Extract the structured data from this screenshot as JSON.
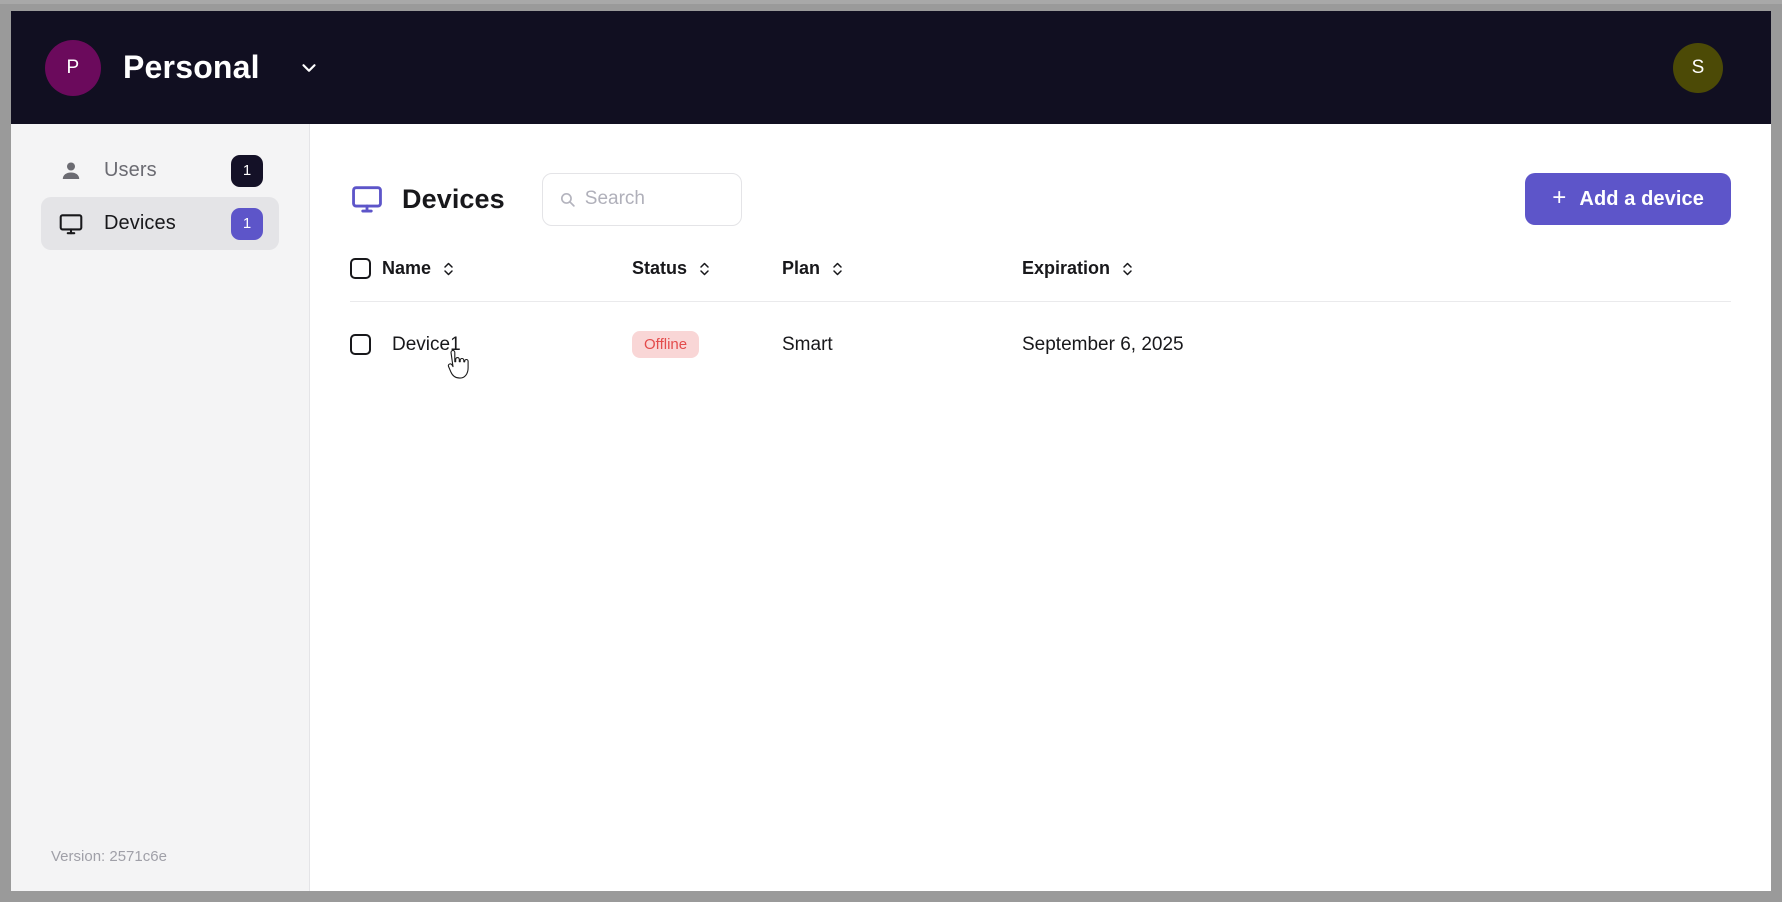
{
  "topbar": {
    "org_avatar_initial": "P",
    "org_avatar_color": "#6b0a5c",
    "org_name": "Personal",
    "org_chevron_icon": "chevron-down-icon",
    "user_avatar_initial": "S",
    "user_avatar_color": "#4c4a06",
    "background_color": "#110f21"
  },
  "sidebar": {
    "items": [
      {
        "icon": "user-icon",
        "label": "Users",
        "badge": "1",
        "badge_color": "#141127",
        "active": false
      },
      {
        "icon": "monitor-icon",
        "label": "Devices",
        "badge": "1",
        "badge_color": "#5d55c9",
        "active": true
      }
    ],
    "version": "Version: 2571c6e"
  },
  "main": {
    "title_icon": "monitor-icon",
    "title": "Devices",
    "accent_color": "#5d55c9",
    "search": {
      "icon": "search-icon",
      "placeholder": "Search",
      "value": ""
    },
    "add_button": {
      "plus": "+",
      "label": "Add a device"
    },
    "table": {
      "columns": [
        {
          "key": "name",
          "label": "Name",
          "sortable": true
        },
        {
          "key": "status",
          "label": "Status",
          "sortable": true
        },
        {
          "key": "plan",
          "label": "Plan",
          "sortable": true
        },
        {
          "key": "expiration",
          "label": "Expiration",
          "sortable": true
        }
      ],
      "rows": [
        {
          "selected": false,
          "name": "Device1",
          "status": "Offline",
          "status_bg": "#f9d6d6",
          "status_fg": "#e34b4b",
          "plan": "Smart",
          "expiration": "September 6, 2025"
        }
      ]
    }
  },
  "cursor": {
    "type": "pointer-hand-cursor"
  }
}
